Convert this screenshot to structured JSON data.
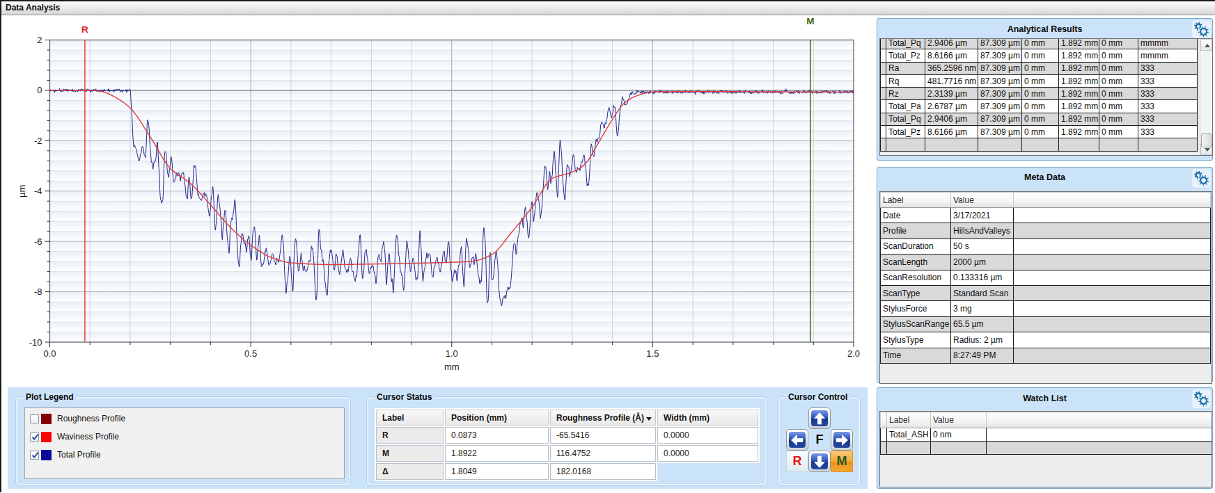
{
  "window": {
    "title": "Data Analysis"
  },
  "theme": {
    "panel_blue": "#cbe3f8",
    "row_grey": "#d9d9d9",
    "gear_color": "#1e6fa8",
    "cursor_r_color": "#e8413c",
    "cursor_m_color": "#4a7a1a",
    "waviness_color": "#e03a3a",
    "total_color": "#26268c",
    "roughness_color": "#8b0000"
  },
  "plot": {
    "xlabel": "mm",
    "ylabel": "µm",
    "x_ticks": [
      "0.0",
      "0.5",
      "1.0",
      "1.5",
      "2.0"
    ],
    "y_ticks": [
      "2",
      "0",
      "-2",
      "-4",
      "-6",
      "-8",
      "-10"
    ],
    "cursors": [
      {
        "name": "R",
        "position_mm": 0.0873,
        "color": "#e01f1f",
        "line_color": "#ee4a48",
        "label_y": 20
      },
      {
        "name": "M",
        "position_mm": 1.8922,
        "color": "#3c6b00",
        "line_color": "#44711c",
        "label_y": 8
      }
    ]
  },
  "chart_data": {
    "type": "line",
    "title": "",
    "xlabel": "mm",
    "ylabel": "µm",
    "xlim": [
      0,
      2
    ],
    "ylim": [
      -10,
      2
    ],
    "x_major_step": 0.5,
    "x_minor_step": 0.1,
    "y_major_step": 2,
    "y_minor_step": 0.4,
    "grid": true,
    "cursors": {
      "R_mm": 0.0873,
      "M_mm": 1.8922
    },
    "series": [
      {
        "name": "Waviness Profile",
        "color": "#e03a3a",
        "points": [
          [
            0,
            0
          ],
          [
            0.1,
            0
          ],
          [
            0.13,
            -0.05
          ],
          [
            0.16,
            -0.25
          ],
          [
            0.2,
            -0.7
          ],
          [
            0.25,
            -1.85
          ],
          [
            0.3,
            -3.1
          ],
          [
            0.35,
            -3.7
          ],
          [
            0.4,
            -4.55
          ],
          [
            0.45,
            -5.45
          ],
          [
            0.5,
            -6.15
          ],
          [
            0.55,
            -6.63
          ],
          [
            0.6,
            -6.85
          ],
          [
            0.7,
            -6.92
          ],
          [
            0.8,
            -6.9
          ],
          [
            0.9,
            -6.87
          ],
          [
            1,
            -6.83
          ],
          [
            1.05,
            -6.79
          ],
          [
            1.1,
            -6.52
          ],
          [
            1.15,
            -5.62
          ],
          [
            1.2,
            -4.64
          ],
          [
            1.25,
            -3.5
          ],
          [
            1.3,
            -3.25
          ],
          [
            1.33,
            -2.95
          ],
          [
            1.37,
            -1.95
          ],
          [
            1.4,
            -1.15
          ],
          [
            1.43,
            -0.5
          ],
          [
            1.46,
            -0.22
          ],
          [
            1.5,
            -0.06
          ],
          [
            1.6,
            -0.05
          ],
          [
            2,
            -0.07
          ]
        ]
      },
      {
        "name": "Total Profile",
        "color": "#26268c",
        "base_points": [
          [
            0,
            0
          ],
          [
            0.15,
            0
          ],
          [
            0.2,
            -0.02
          ],
          [
            0.204,
            -0.8
          ],
          [
            0.209,
            -2.3
          ],
          [
            0.216,
            -2.5
          ],
          [
            0.235,
            -2.3
          ],
          [
            0.26,
            -2.6
          ],
          [
            0.285,
            -3.3
          ],
          [
            0.31,
            -3.3
          ],
          [
            0.34,
            -3.6
          ],
          [
            0.37,
            -4.0
          ],
          [
            0.41,
            -4.7
          ],
          [
            0.45,
            -5.5
          ],
          [
            0.5,
            -6.2
          ],
          [
            0.55,
            -6.65
          ],
          [
            0.62,
            -6.9
          ],
          [
            0.7,
            -6.9
          ],
          [
            0.8,
            -6.92
          ],
          [
            0.9,
            -6.88
          ],
          [
            1,
            -6.84
          ],
          [
            1.05,
            -6.82
          ],
          [
            1.09,
            -6.95
          ],
          [
            1.12,
            -7.8
          ],
          [
            1.135,
            -8.25
          ],
          [
            1.155,
            -6.6
          ],
          [
            1.17,
            -4.95
          ],
          [
            1.185,
            -5.6
          ],
          [
            1.21,
            -4.5
          ],
          [
            1.24,
            -3.55
          ],
          [
            1.28,
            -3.15
          ],
          [
            1.32,
            -3.05
          ],
          [
            1.345,
            -2.85
          ],
          [
            1.365,
            -1.9
          ],
          [
            1.385,
            -1.0
          ],
          [
            1.405,
            -1.1
          ],
          [
            1.425,
            -0.65
          ],
          [
            1.445,
            -0.18
          ],
          [
            1.47,
            -0.07
          ],
          [
            1.6,
            -0.07
          ],
          [
            2,
            -0.07
          ]
        ],
        "noise": {
          "seed": 7,
          "components": [
            [
              0.0115,
              0.17
            ],
            [
              0.0147,
              0.24
            ],
            [
              0.0193,
              0.28
            ],
            [
              0.0241,
              0.24
            ],
            [
              0.0313,
              0.2
            ],
            [
              0.0409,
              0.16
            ],
            [
              0.0527,
              0.14
            ],
            [
              0.0087,
              0.1
            ],
            [
              0.0061,
              0.06
            ],
            [
              0.0043,
              0.04
            ],
            [
              0.0173,
              0.18
            ],
            [
              0.0269,
              0.16
            ],
            [
              0.0359,
              0.12
            ],
            [
              0.0677,
              0.1
            ]
          ],
          "envelope": [
            [
              0,
              0.035
            ],
            [
              0.19,
              0.035
            ],
            [
              0.215,
              0.5
            ],
            [
              0.26,
              0.95
            ],
            [
              0.4,
              1.1
            ],
            [
              0.9,
              1.1
            ],
            [
              1.1,
              1.15
            ],
            [
              1.3,
              1.0
            ],
            [
              1.38,
              0.8
            ],
            [
              1.42,
              0.45
            ],
            [
              1.45,
              0.1
            ],
            [
              1.48,
              0.04
            ],
            [
              2,
              0.04
            ]
          ],
          "am": [
            0.0831,
            0.35
          ],
          "hf": [
            [
              0.0036,
              0.032
            ],
            [
              0.0053,
              0.02
            ],
            [
              0.0029,
              0.018
            ]
          ]
        }
      }
    ]
  },
  "plot_legend": {
    "title": "Plot Legend",
    "items": [
      {
        "label": "Roughness Profile",
        "color": "#820000",
        "checked": false
      },
      {
        "label": "Waviness Profile",
        "color": "#fb0407",
        "checked": true
      },
      {
        "label": "Total Profile",
        "color": "#0a0a99",
        "checked": true
      }
    ]
  },
  "cursor_status": {
    "title": "Cursor Status",
    "columns": [
      "Label",
      "Position (mm)",
      "Roughness Profile (Å)",
      "Width (mm)"
    ],
    "dropdown_column": 2,
    "rows": [
      {
        "label": "R",
        "position": "0.0873",
        "roughness": "-65.5416",
        "width": "0.0000"
      },
      {
        "label": "M",
        "position": "1.8922",
        "roughness": "116.4752",
        "width": "0.0000"
      },
      {
        "label": "Δ",
        "position": "1.8049",
        "roughness": "182.0168",
        "width": null
      }
    ]
  },
  "cursor_control": {
    "title": "Cursor Control",
    "buttons": [
      {
        "name": "up",
        "icon": "arrow-up-icon"
      },
      {
        "name": "left",
        "icon": "arrow-left-icon"
      },
      {
        "name": "focus",
        "label": "F"
      },
      {
        "name": "right",
        "icon": "arrow-right-icon"
      },
      {
        "name": "reference",
        "label": "R"
      },
      {
        "name": "down",
        "icon": "arrow-down-icon"
      },
      {
        "name": "measure",
        "label": "M"
      }
    ]
  },
  "analytical_results": {
    "title": "Analytical Results",
    "rows": [
      [
        "Total_Pq",
        "2.9406 µm",
        "87.309 µm",
        "0 mm",
        "1.892 mm",
        "0 mm",
        "mmmm"
      ],
      [
        "Total_Pz",
        "8.6166 µm",
        "87.309 µm",
        "0 mm",
        "1.892 mm",
        "0 mm",
        "mmmm"
      ],
      [
        "Ra",
        "365.2596 nm",
        "87.309 µm",
        "0 mm",
        "1.892 mm",
        "0 mm",
        "333"
      ],
      [
        "Rq",
        "481.7716 nm",
        "87.309 µm",
        "0 mm",
        "1.892 mm",
        "0 mm",
        "333"
      ],
      [
        "Rz",
        "2.3139 µm",
        "87.309 µm",
        "0 mm",
        "1.892 mm",
        "0 mm",
        "333"
      ],
      [
        "Total_Pa",
        "2.6787 µm",
        "87.309 µm",
        "0 mm",
        "1.892 mm",
        "0 mm",
        "333"
      ],
      [
        "Total_Pq",
        "2.9406 µm",
        "87.309 µm",
        "0 mm",
        "1.892 mm",
        "0 mm",
        "333"
      ],
      [
        "Total_Pz",
        "8.6166 µm",
        "87.309 µm",
        "0 mm",
        "1.892 mm",
        "0 mm",
        "333"
      ],
      [
        "",
        "",
        "",
        "",
        "",
        "",
        ""
      ]
    ]
  },
  "meta_data": {
    "title": "Meta Data",
    "columns": [
      "Label",
      "Value"
    ],
    "rows": [
      [
        "Date",
        "3/17/2021"
      ],
      [
        "Profile",
        "HillsAndValleys"
      ],
      [
        "ScanDuration",
        "50 s"
      ],
      [
        "ScanLength",
        "2000 µm"
      ],
      [
        "ScanResolution",
        "0.133316 µm"
      ],
      [
        "ScanType",
        "Standard Scan"
      ],
      [
        "StylusForce",
        "3 mg"
      ],
      [
        "StylusScanRange",
        "65.5 µm"
      ],
      [
        "StylusType",
        "Radius: 2 µm"
      ],
      [
        "Time",
        "8:27:49 PM"
      ]
    ]
  },
  "watch_list": {
    "title": "Watch List",
    "columns": [
      "Label",
      "Value"
    ],
    "rows": [
      [
        "Total_ASH",
        "0 nm"
      ]
    ]
  }
}
